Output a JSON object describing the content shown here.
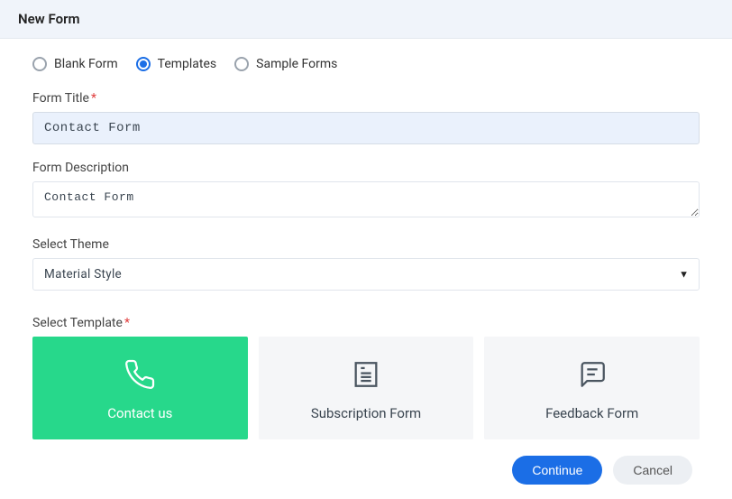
{
  "header": {
    "title": "New Form"
  },
  "radios": {
    "blank": "Blank Form",
    "templates": "Templates",
    "sample": "Sample Forms",
    "selected": "templates"
  },
  "fields": {
    "title_label": "Form Title",
    "title_value": "Contact Form",
    "desc_label": "Form Description",
    "desc_value": "Contact Form",
    "theme_label": "Select Theme",
    "theme_value": "Material Style",
    "template_label": "Select Template"
  },
  "templates": {
    "contact": "Contact us",
    "subscription": "Subscription Form",
    "feedback": "Feedback Form"
  },
  "buttons": {
    "continue": "Continue",
    "cancel": "Cancel"
  }
}
